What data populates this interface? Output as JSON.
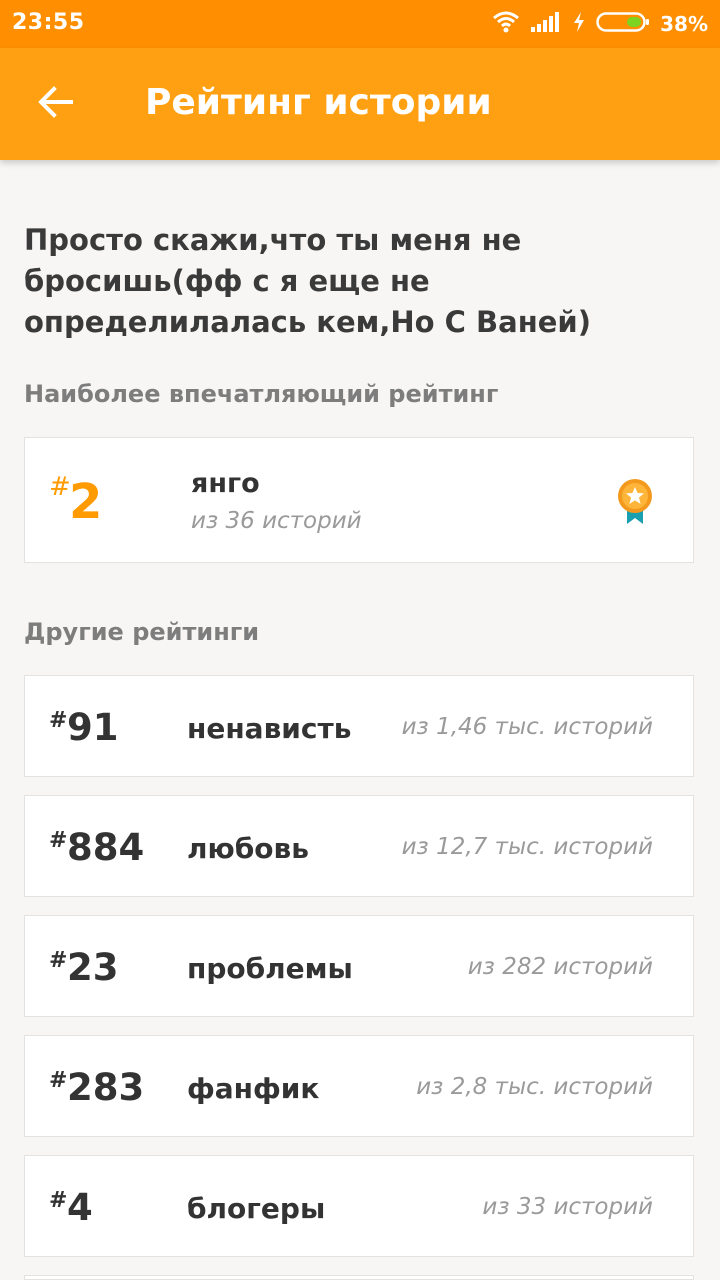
{
  "status_bar": {
    "time": "23:55",
    "battery_percent": "38%",
    "icons": [
      "wifi-icon",
      "signal-icon",
      "charging-icon",
      "battery-icon"
    ]
  },
  "app_bar": {
    "back_icon": "arrow-left-icon",
    "title": "Рейтинг истории"
  },
  "story": {
    "title": "Просто скажи,что ты меня не бросишь(фф с я еще не определилалась кем,Но С Ваней)"
  },
  "best_section": {
    "label": "Наиболее впечатляющий рейтинг",
    "card": {
      "hash": "#",
      "rank": "2",
      "tag": "янго",
      "count": "из 36 историй",
      "badge_icon": "award-badge-icon"
    }
  },
  "other_section": {
    "label": "Другие рейтинги",
    "items": [
      {
        "hash": "#",
        "rank": "91",
        "tag": "ненависть",
        "count": "из 1,46 тыс. историй"
      },
      {
        "hash": "#",
        "rank": "884",
        "tag": "любовь",
        "count": "из 12,7 тыс. историй"
      },
      {
        "hash": "#",
        "rank": "23",
        "tag": "проблемы",
        "count": "из 282 историй"
      },
      {
        "hash": "#",
        "rank": "283",
        "tag": "фанфик",
        "count": "из 2,8 тыс. историй"
      },
      {
        "hash": "#",
        "rank": "4",
        "tag": "блогеры",
        "count": "из 33 историй"
      }
    ]
  },
  "colors": {
    "status_bar": "#ff8f00",
    "app_bar": "#ffa012",
    "accent": "#ff9a00",
    "badge_ribbon": "#1a9fb0",
    "background": "#f7f6f4"
  }
}
